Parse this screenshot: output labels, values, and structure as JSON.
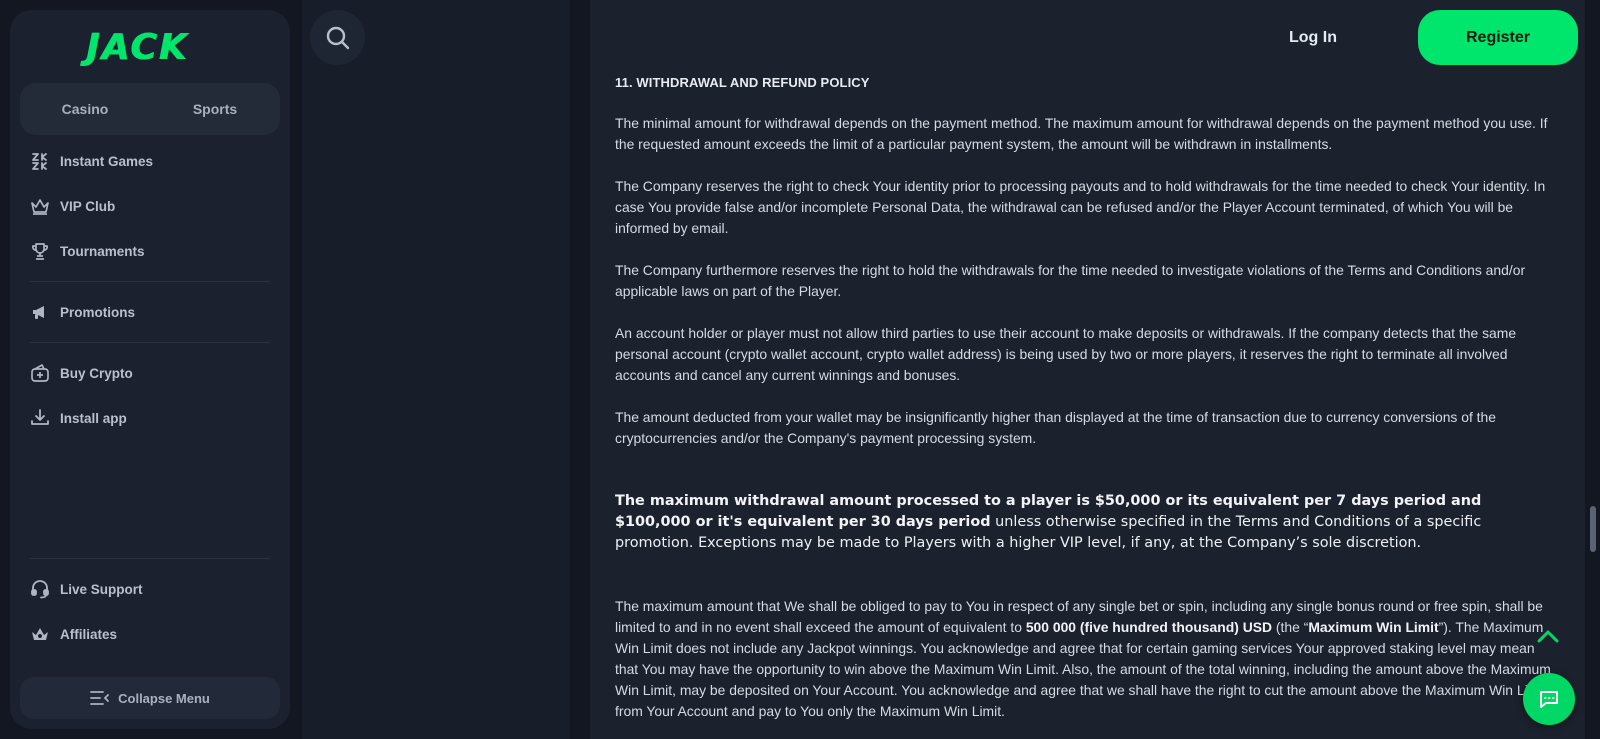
{
  "brand": {
    "logo_text": "JACK",
    "accent_color": "#00e56b"
  },
  "sidebar": {
    "tabs": [
      {
        "label": "Casino"
      },
      {
        "label": "Sports"
      }
    ],
    "items": [
      {
        "label": "Instant Games",
        "icon": "instant-games-icon"
      },
      {
        "label": "VIP Club",
        "icon": "crown-icon"
      },
      {
        "label": "Tournaments",
        "icon": "trophy-icon"
      },
      {
        "label": "Promotions",
        "icon": "megaphone-icon"
      },
      {
        "label": "Buy Crypto",
        "icon": "crypto-wallet-icon"
      },
      {
        "label": "Install app",
        "icon": "download-icon"
      },
      {
        "label": "Live Support",
        "icon": "headset-icon"
      },
      {
        "label": "Affiliates",
        "icon": "affiliates-icon"
      }
    ],
    "collapse_label": "Collapse Menu"
  },
  "header": {
    "search_icon": "search-icon",
    "login_label": "Log In",
    "register_label": "Register"
  },
  "content": {
    "heading": "11. WITHDRAWAL AND REFUND POLICY",
    "p1": "The minimal amount for withdrawal depends on the payment method. The maximum amount for withdrawal depends on the payment method you use. If the requested amount exceeds the limit of a particular payment system, the amount will be withdrawn in installments.",
    "p2": "The Company reserves the right to check Your identity prior to processing payouts and to hold withdrawals for the time needed to check Your identity. In case You provide false and/or incomplete Personal Data, the withdrawal can be refused and/or the Player Account terminated, of which You will be informed by email.",
    "p3": "The Company furthermore reserves the right to hold the withdrawals for the time needed to investigate violations of the Terms and Conditions and/or applicable laws on part of the Player.",
    "p4": "An account holder or player must not allow third parties to use their account to make deposits or withdrawals. If the company detects that the same personal account (crypto wallet account, crypto wallet address) is being used by two or more players, it reserves the right to terminate all involved accounts and cancel any current winnings and bonuses.",
    "p5": "The amount deducted from your wallet may be insignificantly higher than displayed at the time of transaction due to currency conversions of the cryptocurrencies and/or the Company's payment processing system.",
    "p6_bold": "The maximum withdrawal amount processed to a player is $50,000 or its equivalent per 7 days period and $100,000 or it's equivalent per 30 days period",
    "p6_rest": " unless otherwise specified in the Terms and Conditions of a specific promotion. Exceptions may be made to Players with a higher VIP level, if any, at the Company’s sole discretion.",
    "p7_a": "The maximum amount that We shall be obliged to pay to You in respect of any single bet or spin, including any single bonus round or free spin, shall be limited to and in no event shall exceed the amount of equivalent to ",
    "p7_b1": "500 000 (five hundred thousand) USD",
    "p7_c": " (the “",
    "p7_b2": "Maximum Win Limit",
    "p7_d": "”). The Maximum Win Limit does not include any Jackpot winnings. You acknowledge and agree that for certain gaming services Your approved staking level may mean that You may have the opportunity to win above the Maximum Win Limit. Also, the amount of the total winning, including the amount above the Maximum Win Limit, may be deposited on Your Account. You acknowledge and agree that we shall have the right to cut the amount above the Maximum Win Limit from Your Account and pay to You only the Maximum Win Limit."
  },
  "floating": {
    "to_top_icon": "chevron-up-icon",
    "chat_icon": "chat-icon"
  }
}
